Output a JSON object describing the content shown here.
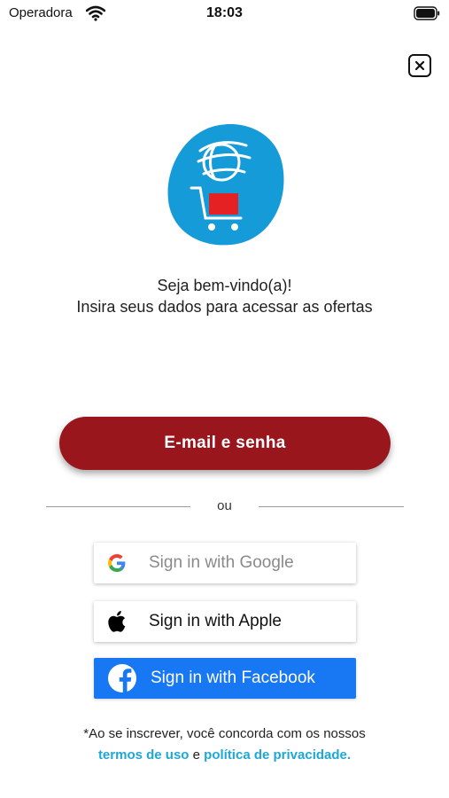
{
  "status_bar": {
    "carrier": "Operadora",
    "time": "18:03",
    "wifi_icon": "wifi-icon",
    "battery_icon": "battery-icon"
  },
  "close_icon": "close-icon",
  "logo_icon": "globe-shopping-cart-logo",
  "welcome": {
    "line1": "Seja bem-vindo(a)!",
    "line2": "Insira seus dados para acessar as ofertas"
  },
  "primary_button": {
    "label": "E-mail e senha",
    "color": "#98161c"
  },
  "divider": {
    "text": "ou"
  },
  "social": {
    "google": {
      "label": "Sign in with Google",
      "icon": "google-icon"
    },
    "apple": {
      "label": "Sign in with Apple",
      "icon": "apple-icon"
    },
    "facebook": {
      "label": "Sign in with Facebook",
      "icon": "facebook-icon",
      "color": "#1877f2"
    }
  },
  "terms": {
    "text": "*Ao se inscrever, você concorda com os nossos",
    "terms_link": "termos de uso",
    "connector": "e",
    "privacy_link": "política de privacidade.",
    "link_color": "#1ea7d8"
  }
}
